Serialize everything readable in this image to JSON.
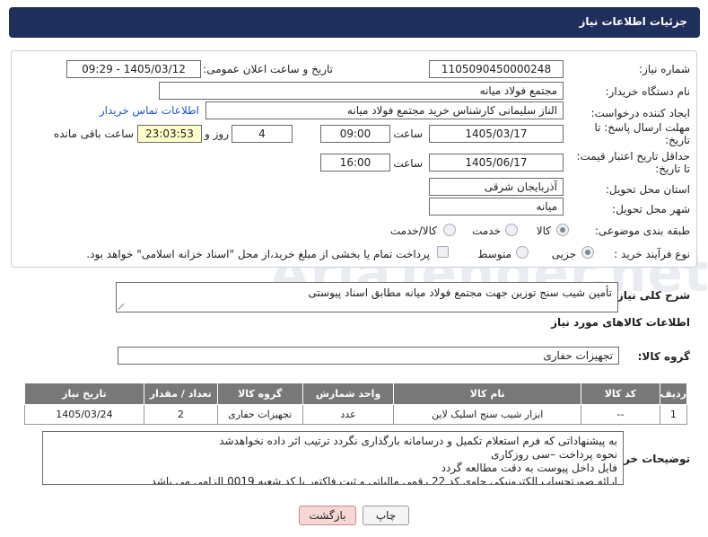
{
  "header": {
    "title": "جزئیات اطلاعات نیاز"
  },
  "form": {
    "need_number": {
      "label": "شماره نیاز:",
      "value": "1105090450000248"
    },
    "announce": {
      "label": "تاریخ و ساعت اعلان عمومی:",
      "value": "1405/03/12 - 09:29"
    },
    "buyer_org": {
      "label": "نام دستگاه خریدار:",
      "value": "مجتمع فولاد میانه"
    },
    "requester": {
      "label": "ایجاد کننده درخواست:",
      "value": "الناز سلیمانی کارشناس خرید مجتمع فولاد میانه",
      "contact_link": "اطلاعات تماس خریدار"
    },
    "deadline": {
      "label_line1": "مهلت ارسال پاسخ: تا",
      "label_line2": "تاریخ:",
      "date": "1405/03/17",
      "time_label": "ساعت",
      "time": "09:00",
      "days": "4",
      "days_label": "روز و",
      "remaining": "23:03:53",
      "remaining_label": "ساعت باقی مانده"
    },
    "validity": {
      "label_line1": "حداقل تاریخ اعتبار قیمت:",
      "label_line2": "تا تاریخ:",
      "date": "1405/06/17",
      "time_label": "ساعت",
      "time": "16:00"
    },
    "province": {
      "label": "استان محل تحویل:",
      "value": "آذربایجان شرقی"
    },
    "city": {
      "label": "شهر محل تحویل:",
      "value": "میانه"
    },
    "category": {
      "label": "طبقه بندی موضوعی:",
      "options": [
        "کالا",
        "خدمت",
        "کالا/خدمت"
      ]
    },
    "process": {
      "label": "نوع فرآیند خرید :",
      "options": [
        "جزیی",
        "متوسط"
      ],
      "payment_note": "پرداخت تمام یا بخشی از مبلغ خرید،از محل \"اسناد خزانه اسلامی\" خواهد بود."
    }
  },
  "summary": {
    "label": "شرح کلی نیاز:",
    "value": "تأمین شیب سنج توزین جهت مجتمع فولاد میانه مطابق اسناد پیوستی"
  },
  "goods_section": {
    "title": "اطلاعات کالاهای مورد نیاز"
  },
  "goods_group": {
    "label": "گروه کالا:",
    "value": "تجهیزات حفاری"
  },
  "table": {
    "headers": [
      "ردیف",
      "کد کالا",
      "نام کالا",
      "واحد شمارش",
      "گروه کالا",
      "تعداد / مقدار",
      "تاریخ نیاز"
    ],
    "rows": [
      [
        "1",
        "--",
        "ابزار شیب سنج اسلیک لاین",
        "عدد",
        "تجهیزات حفاری",
        "2",
        "1405/03/24"
      ]
    ]
  },
  "buyer_notes": {
    "label": "توضیحات خریدار:",
    "lines": [
      "به پیشنهاداتی که فرم استعلام تکمیل و درسامانه بارگذاری نگردد ترتیب اثر داده نخواهدشد",
      "نحوه پرداخت –سی روزکاری",
      "فایل داخل پیوست به دقت مطالعه گردد",
      "ارائه صورتحساب الکترونیکی حاوی کد 22 رقمی مالیاتی و ثبت فاکتور با کد شعبه 0019 الزامی می باشد"
    ]
  },
  "buttons": {
    "print": "چاپ",
    "back": "بازگشت"
  },
  "watermark": {
    "text": "AriaTender.net"
  },
  "colors": {
    "header_bg": "#1e2f5c",
    "table_header_bg": "#787878",
    "link": "#1a56c8",
    "highlight_field": "#ffffcc",
    "back_button": "#f7d6d6"
  }
}
